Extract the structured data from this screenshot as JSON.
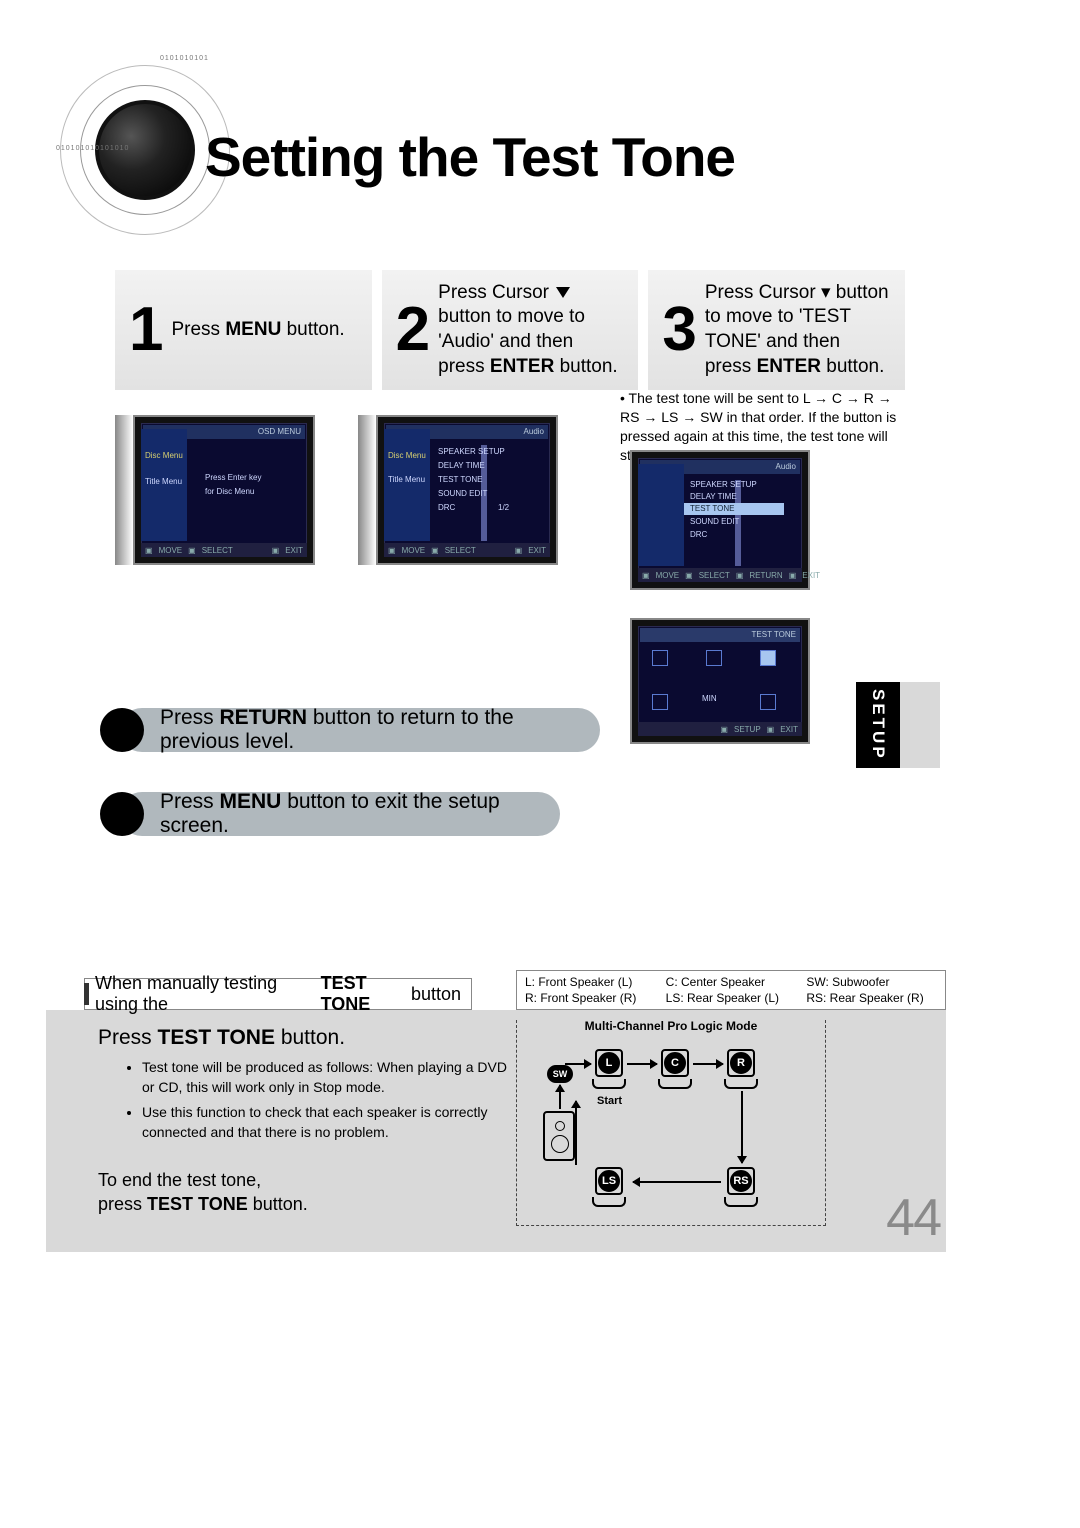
{
  "title": "Setting the Test Tone",
  "steps": {
    "s1": {
      "num": "1",
      "text_pre": "Press ",
      "bold": "MENU",
      "text_post": " button."
    },
    "s2": {
      "num": "2",
      "line1": "Press Cursor ",
      "line2": "button to move to 'Audio' and then press ",
      "bold": "ENTER",
      "line3": " button."
    },
    "s3": {
      "num": "3",
      "t": "Press Cursor ▾ button to move to 'TEST TONE' and then press ",
      "bold": "ENTER",
      "post": " button."
    }
  },
  "note": "The test tone will be sent to L → C → R → RS → LS → SW in that order. If the button is pressed again at this time, the test tone will stop.",
  "pill1_pre": "Press ",
  "pill1_b": "RETURN",
  "pill1_post": " button to return to the previous level.",
  "pill2_pre": "Press ",
  "pill2_b": "MENU",
  "pill2_post": " button to exit the setup screen.",
  "setup_tab": "SETUP",
  "panel": {
    "bar_pre": "When manually testing using the ",
    "bar_b": "TEST TONE",
    "bar_post": " button",
    "legend": {
      "l": "L: Front Speaker (L)",
      "c": "C: Center Speaker",
      "sw": "SW: Subwoofer",
      "r": "R: Front Speaker (R)",
      "ls": "LS: Rear Speaker (L)",
      "rs": "RS: Rear Speaker (R)"
    },
    "sect_pre": "Press ",
    "sect_b": "TEST TONE",
    "sect_post": " button.",
    "bul1": "Test tone will be produced as follows: When playing a DVD or CD, this will work only in Stop mode.",
    "bul2": "Use this function to check that each speaker is correctly connected and that there is no problem.",
    "end1": "To end the test tone,",
    "end2_pre": "press ",
    "end2_b": "TEST TONE",
    "end2_post": " button.",
    "diag_title": "Multi-Channel Pro Logic Mode",
    "diag_start": "Start",
    "spk": {
      "L": "L",
      "C": "C",
      "R": "R",
      "SW": "SW",
      "LS": "LS",
      "RS": "RS"
    }
  },
  "osd": {
    "s1_hdr_r": "OSD  MENU",
    "s1_a": "Disc Menu",
    "s1_c": "Title Menu",
    "s1_line1": "Press Enter key",
    "s1_line2": "for Disc Menu",
    "s1_f1": "MOVE",
    "s1_f2": "SELECT",
    "s1_f3": "EXIT",
    "s2_hdr_r": "Audio",
    "s2_i1": "SPEAKER SETUP",
    "s2_i2": "DELAY TIME",
    "s2_i3": "TEST TONE",
    "s2_i4": "SOUND EDIT",
    "s2_i5": "DRC",
    "s2_i5r": "1/2",
    "s3_hl": "TEST TONE",
    "s4_hdr_l": "",
    "s4_hdr_r": "TEST TONE",
    "s4_min": "MIN",
    "s4_f1": "SETUP",
    "s4_f2": "EXIT",
    "f_move": "MOVE",
    "f_sel": "SELECT",
    "f_ret": "RETURN",
    "f_exit": "EXIT"
  },
  "page_number": "44"
}
